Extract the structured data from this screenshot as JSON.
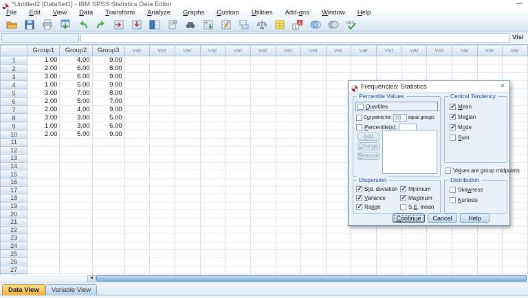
{
  "window": {
    "title": "*Untitled2 [DataSet1] - IBM SPSS Statistics Data Editor"
  },
  "menu": {
    "items": [
      "[F]ile",
      "[E]dit",
      "[V]iew",
      "[D]ata",
      "[T]ransform",
      "[A]nalyze",
      "[G]raphs",
      "[C]ustom",
      "[U]tilities",
      "Add-[o]ns",
      "[W]indow",
      "[H]elp"
    ]
  },
  "toolbar": {
    "icons": [
      "open-data",
      "save",
      "print",
      "recall-dialogs",
      "undo",
      "redo",
      "goto-case",
      "goto-variable",
      "variables",
      "file-info",
      "find",
      "insert-cases",
      "insert-variable",
      "split-file",
      "weight-cases",
      "value-labels-grid",
      "value-labels",
      "use-variable-sets",
      "show-all-variables",
      "spell-check"
    ]
  },
  "formula_bar": {
    "cell_ref": "",
    "cell_value": "",
    "visible_label": "Visi"
  },
  "grid": {
    "columns": [
      "Group1",
      "Group2",
      "Group3"
    ],
    "var_label": "var",
    "var_count": 16,
    "row_count": 28,
    "rows": [
      [
        "1.00",
        "4.00",
        "9.00"
      ],
      [
        "2.00",
        "6.00",
        "8.00"
      ],
      [
        "3.00",
        "6.00",
        "9.00"
      ],
      [
        "1.00",
        "5.00",
        "9.00"
      ],
      [
        "3.00",
        "7.00",
        "8.00"
      ],
      [
        "2.00",
        "5.00",
        "7.00"
      ],
      [
        "2.00",
        "4.00",
        "9.00"
      ],
      [
        "3.00",
        "3.00",
        "5.00"
      ],
      [
        "1.00",
        "3.00",
        "6.00"
      ],
      [
        "2.00",
        "5.00",
        "9.00"
      ]
    ]
  },
  "tabs": {
    "data_view": "Data View",
    "variable_view": "Variable View",
    "active": "Data View"
  },
  "dialog": {
    "title": "Frequencies: Statistics",
    "close_glyph": "×",
    "percentile": {
      "title": "Percentile Values",
      "quartiles": {
        "label": "[Q]uartiles",
        "checked": false
      },
      "cut_points": {
        "label": "C[u]t points for:",
        "checked": false,
        "value": "10",
        "suffix": "equal groups"
      },
      "percentiles": {
        "label": "[P]ercentile(s):",
        "checked": false,
        "value": ""
      },
      "add_label": "[A]dd",
      "change_label": "[C]hange",
      "remove_label": "[R]emove"
    },
    "central_tendency": {
      "title": "Central Tendency",
      "items": [
        {
          "label": "[M]ean",
          "checked": true
        },
        {
          "label": "Me[d]ian",
          "checked": true
        },
        {
          "label": "M[o]de",
          "checked": true
        },
        {
          "label": "[S]um",
          "checked": false
        }
      ]
    },
    "midpoints": {
      "label": "Va[l]ues are group midpoints",
      "checked": false
    },
    "dispersion": {
      "title": "Dispersion",
      "items": [
        {
          "label": "S[t]d. deviation",
          "checked": true
        },
        {
          "label": "M[i]nimum",
          "checked": true
        },
        {
          "label": "[V]ariance",
          "checked": true
        },
        {
          "label": "Ma[x]imum",
          "checked": true
        },
        {
          "label": "Ra[n]ge",
          "checked": true
        },
        {
          "label": "S.[E]. mean",
          "checked": false
        }
      ]
    },
    "distribution": {
      "title": "Distribution",
      "items": [
        {
          "label": "Ske[w]ness",
          "checked": false
        },
        {
          "label": "[K]urtosis",
          "checked": false
        }
      ]
    },
    "buttons": {
      "continue_label": "[C]ontinue",
      "cancel_label": "Cancel",
      "help_label": "Help"
    }
  },
  "scrollbar": {
    "left_arrow": "◀"
  },
  "colors": {
    "toolbar_top": "#f3f8fc",
    "toolbar_bottom": "#d5e3f1",
    "grid_header_top": "#f6f9fc",
    "grid_header_bottom": "#d3e0ef",
    "gridline": "#d4e0ec",
    "dialog_bg": "#e9f0f8",
    "group_title": "#2b4a9c",
    "checkmark": "#222f7d",
    "button_top": "#e9f3fc",
    "button_bottom": "#b7d5ef",
    "tab_active_top": "#fbe08c",
    "tab_active_bottom": "#f3ae45",
    "tab_inactive_top": "#e2eef9",
    "tab_inactive_bottom": "#b6d2ec",
    "scroll_thumb": "#7fb2e0"
  }
}
